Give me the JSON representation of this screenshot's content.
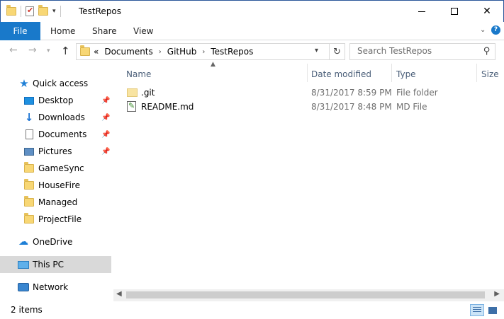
{
  "window": {
    "title": "TestRepos"
  },
  "ribbon": {
    "tabs": [
      "File",
      "Home",
      "Share",
      "View"
    ]
  },
  "address": {
    "overflow": "«",
    "crumbs": [
      "Documents",
      "GitHub",
      "TestRepos"
    ]
  },
  "search": {
    "placeholder": "Search TestRepos"
  },
  "sidebar": {
    "quick_access": "Quick access",
    "items": [
      {
        "label": "Desktop",
        "pinned": true
      },
      {
        "label": "Downloads",
        "pinned": true
      },
      {
        "label": "Documents",
        "pinned": true
      },
      {
        "label": "Pictures",
        "pinned": true
      },
      {
        "label": "GameSync",
        "pinned": false
      },
      {
        "label": "HouseFire",
        "pinned": false
      },
      {
        "label": "Managed",
        "pinned": false
      },
      {
        "label": "ProjectFile",
        "pinned": false
      }
    ],
    "onedrive": "OneDrive",
    "this_pc": "This PC",
    "network": "Network"
  },
  "columns": {
    "name": "Name",
    "date": "Date modified",
    "type": "Type",
    "size": "Size"
  },
  "files": [
    {
      "name": ".git",
      "date": "8/31/2017 8:59 PM",
      "type": "File folder",
      "icon": "folder-icon"
    },
    {
      "name": "README.md",
      "date": "8/31/2017 8:48 PM",
      "type": "MD File",
      "icon": "markdown-file-icon"
    }
  ],
  "status": {
    "count": "2 items"
  },
  "colors": {
    "accent": "#1979ca",
    "selection": "#d9d9d9",
    "header_text": "#4c607a"
  }
}
